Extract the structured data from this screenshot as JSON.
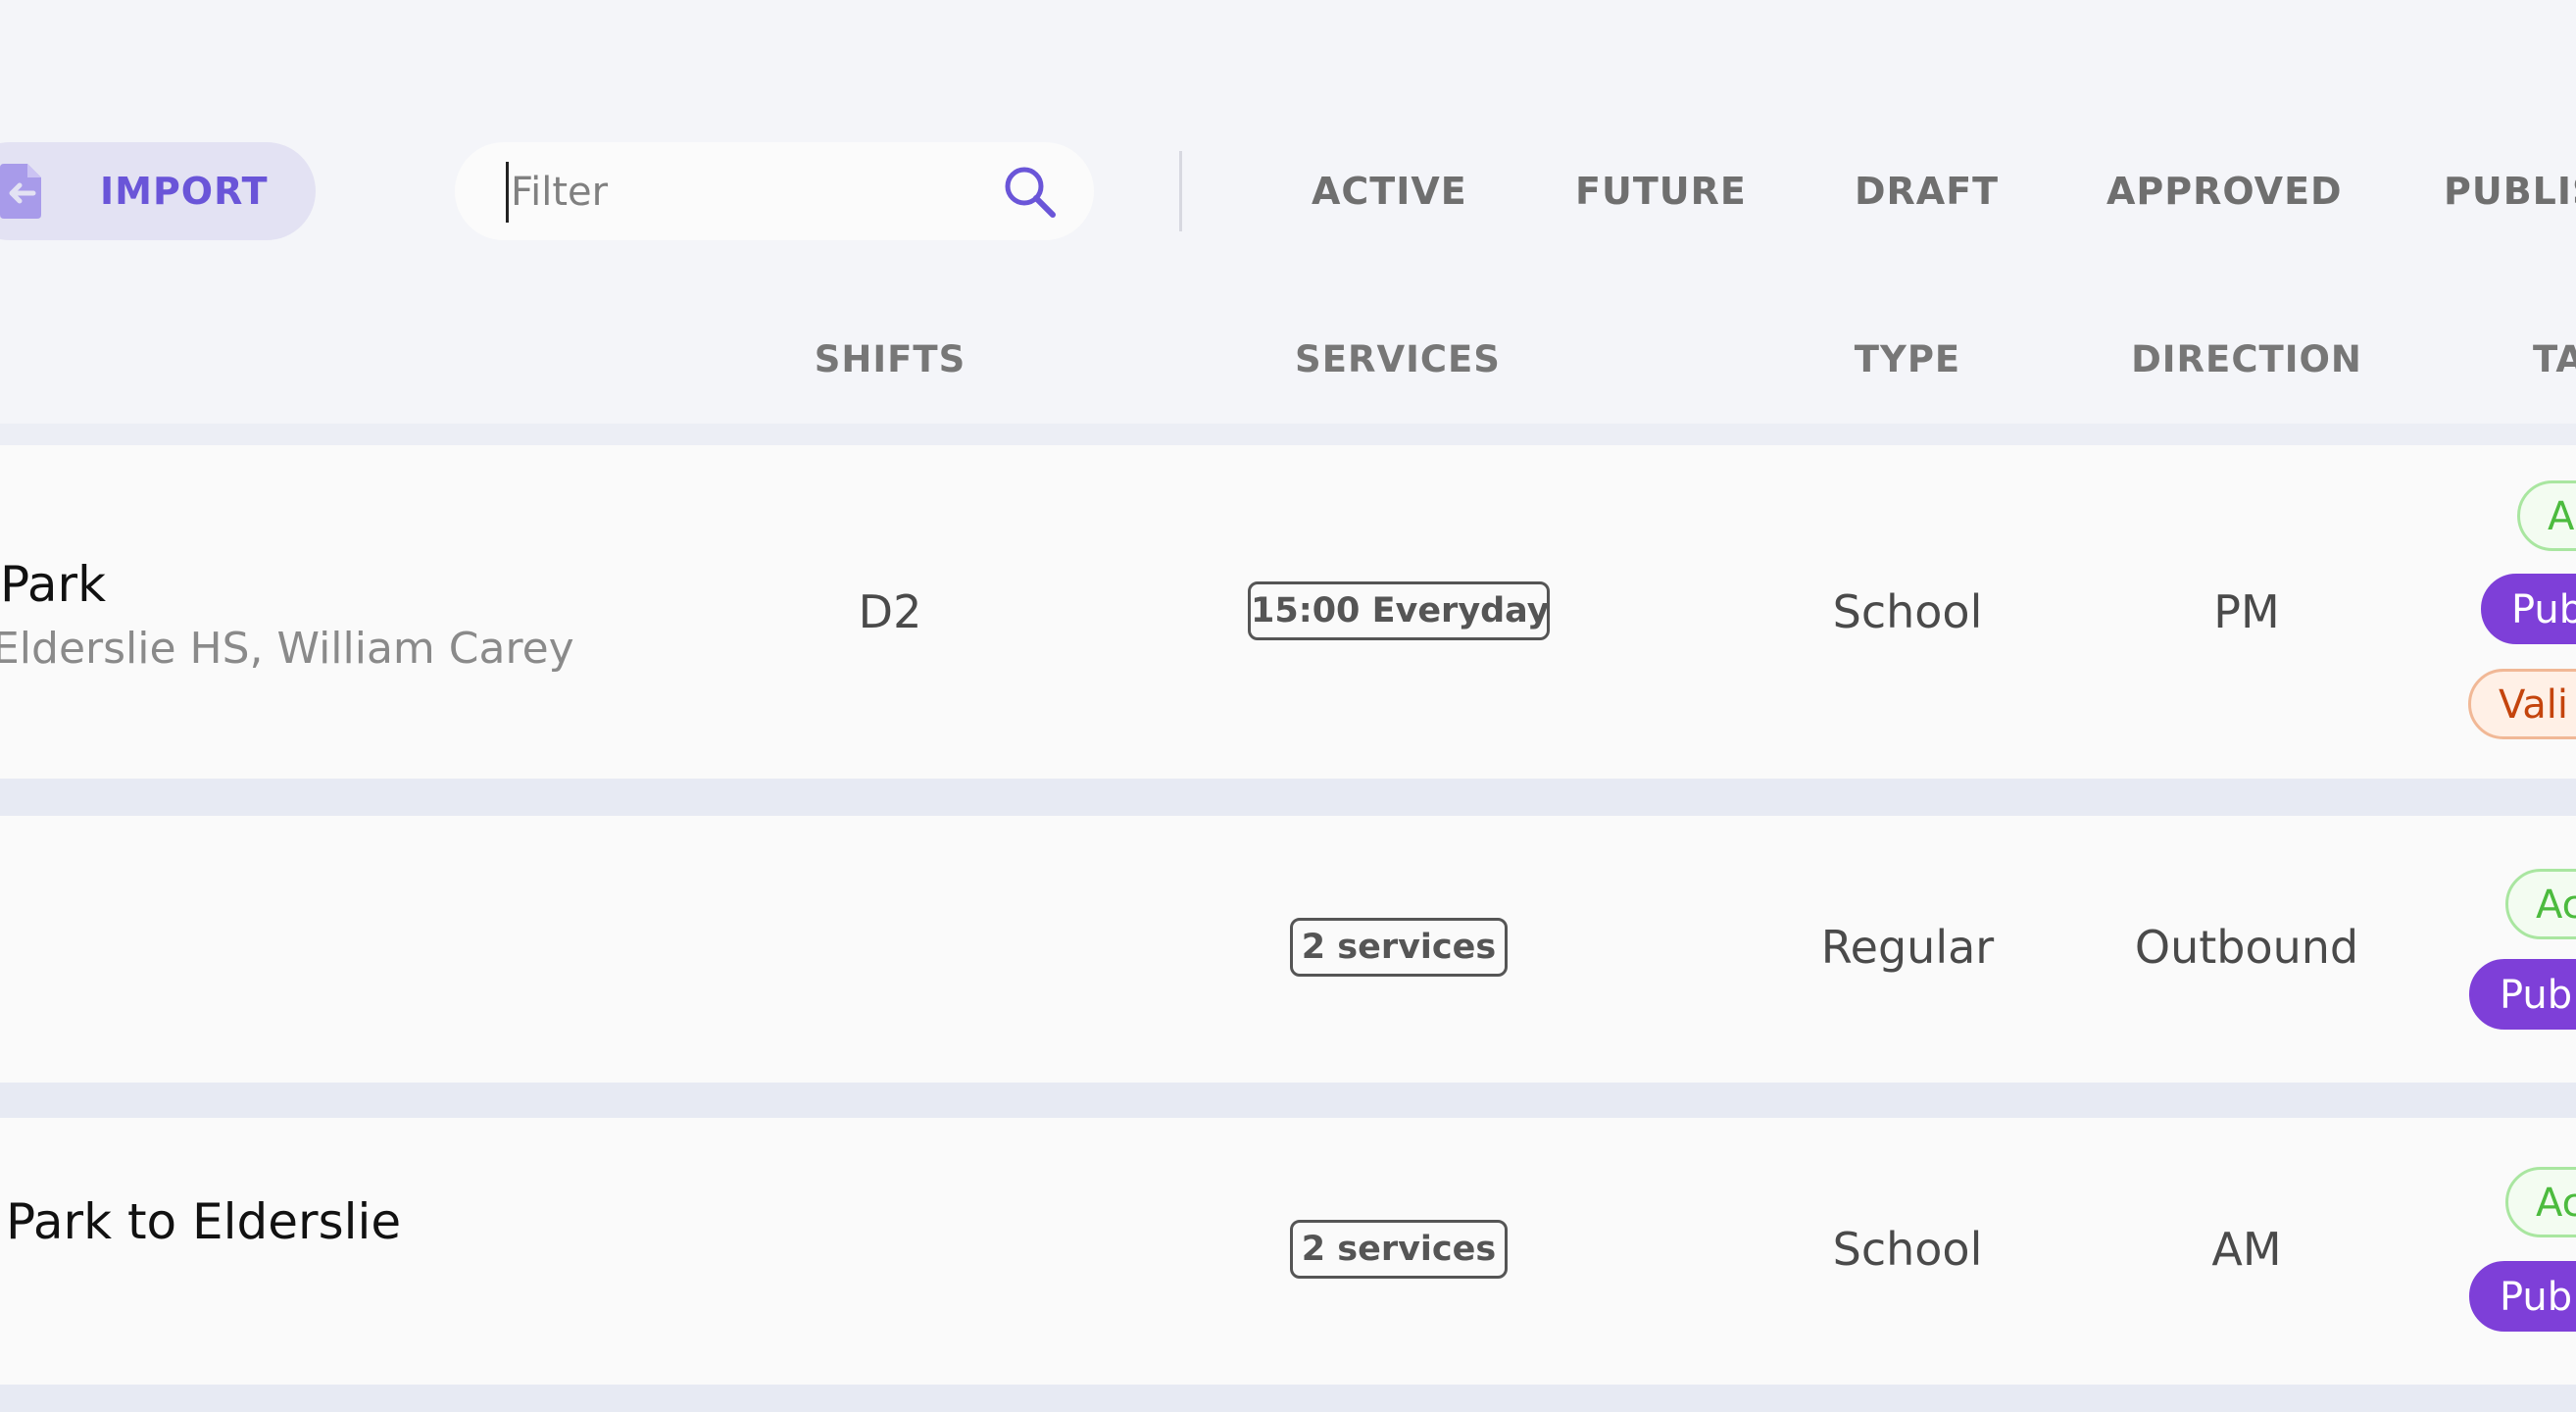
{
  "toolbar": {
    "import_label": "IMPORT",
    "filter_placeholder": "Filter",
    "tabs": [
      "ACTIVE",
      "FUTURE",
      "DRAFT",
      "APPROVED",
      "PUBLIS"
    ]
  },
  "columns": {
    "shifts": "SHIFTS",
    "services": "SERVICES",
    "type": "TYPE",
    "direction": "DIRECTION",
    "tags": "TA"
  },
  "rows": [
    {
      "title": "Park",
      "subtitle": "Elderslie HS, William Carey",
      "shift": "D2",
      "services": "15:00 Everyday",
      "type": "School",
      "direction": "PM",
      "tags": [
        "A",
        "Pub",
        "Vali"
      ]
    },
    {
      "title": "",
      "subtitle": "",
      "shift": "",
      "services": "2 services",
      "type": "Regular",
      "direction": "Outbound",
      "tags": [
        "Ac",
        "Pub"
      ]
    },
    {
      "title": "Park to Elderslie",
      "subtitle": "",
      "shift": "",
      "services": "2 services",
      "type": "School",
      "direction": "AM",
      "tags": [
        "Ac",
        "Pub"
      ]
    }
  ],
  "colors": {
    "accent": "#6a55d8",
    "published": "#7e3fd8",
    "active": "#4cbb3e",
    "validation": "#c4440c"
  },
  "icons": {
    "import": "import-file-icon",
    "search": "search-icon"
  }
}
